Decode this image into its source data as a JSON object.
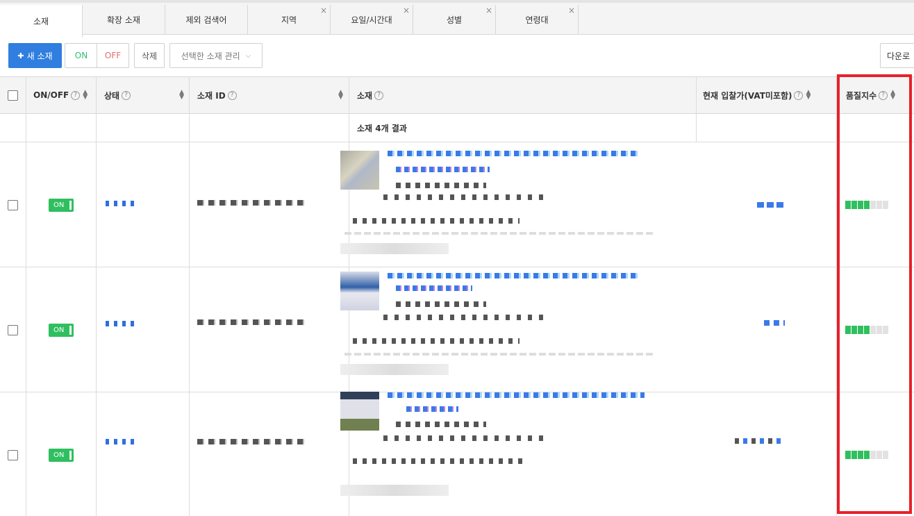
{
  "tabs": [
    {
      "label": "소재",
      "active": true,
      "closable": false
    },
    {
      "label": "확장 소재",
      "active": false,
      "closable": false
    },
    {
      "label": "제외 검색어",
      "active": false,
      "closable": false
    },
    {
      "label": "지역",
      "active": false,
      "closable": true
    },
    {
      "label": "요일/시간대",
      "active": false,
      "closable": true
    },
    {
      "label": "성별",
      "active": false,
      "closable": true
    },
    {
      "label": "연령대",
      "active": false,
      "closable": true
    }
  ],
  "close_glyph": "×",
  "toolbar": {
    "new_label": "새 소재",
    "new_icon": "✚",
    "on_label": "ON",
    "off_label": "OFF",
    "delete_label": "삭제",
    "manage_label": "선택한 소재 관리",
    "download_label": "다운로"
  },
  "columns": {
    "onoff": "ON/OFF",
    "status": "상태",
    "id": "소재 ID",
    "creative": "소재",
    "bid": "현재 입찰가(VAT미포함)",
    "quality": "품질지수"
  },
  "help_glyph": "?",
  "summary": "소재 4개 결과",
  "rows": [
    {
      "toggle": "ON",
      "quality": 4,
      "quality_max": 7
    },
    {
      "toggle": "ON",
      "quality": 4,
      "quality_max": 7
    },
    {
      "toggle": "ON",
      "quality": 4,
      "quality_max": 7
    }
  ],
  "colors": {
    "accent": "#2f7ee0",
    "on": "#2fbf5f",
    "highlight": "#e8202a"
  }
}
